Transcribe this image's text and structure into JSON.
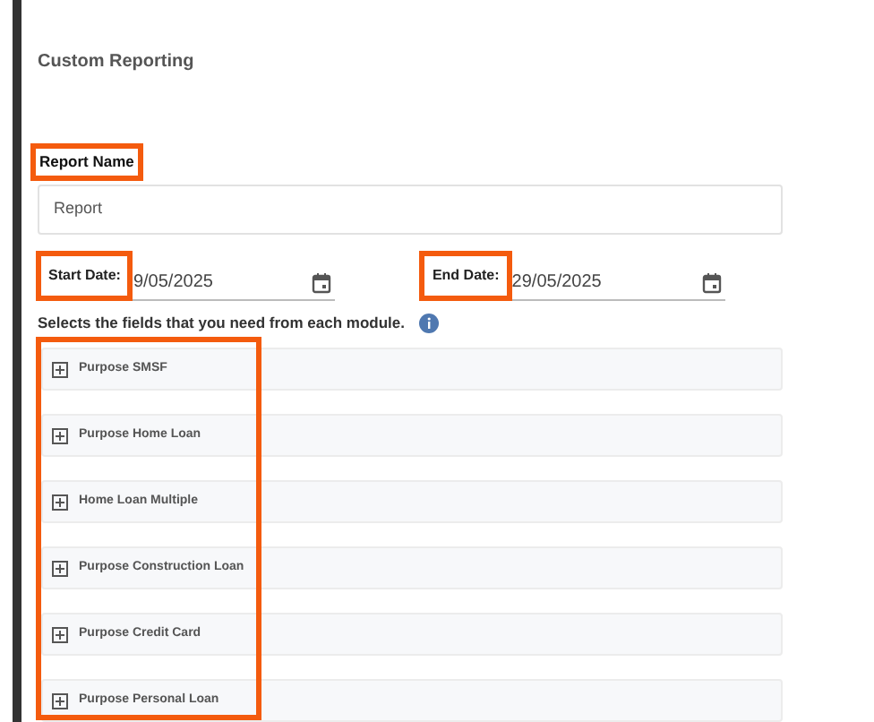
{
  "title": "Custom Reporting",
  "report_name": {
    "label": "Report Name",
    "highlighted": true,
    "value": "Report"
  },
  "start_date": {
    "label": "Start Date:",
    "highlighted": true,
    "value": "9/05/2025"
  },
  "end_date": {
    "label": "End Date:",
    "highlighted": true,
    "value": "29/05/2025"
  },
  "instruction": "Selects the fields that you need from each module.",
  "modules_highlighted": true,
  "modules": [
    {
      "label": "Purpose SMSF",
      "expanded": false
    },
    {
      "label": "Purpose Home Loan",
      "expanded": false
    },
    {
      "label": "Home Loan Multiple",
      "expanded": false
    },
    {
      "label": "Purpose Construction Loan",
      "expanded": false
    },
    {
      "label": "Purpose Credit Card",
      "expanded": false
    },
    {
      "label": "Purpose Personal Loan",
      "expanded": false
    }
  ]
}
